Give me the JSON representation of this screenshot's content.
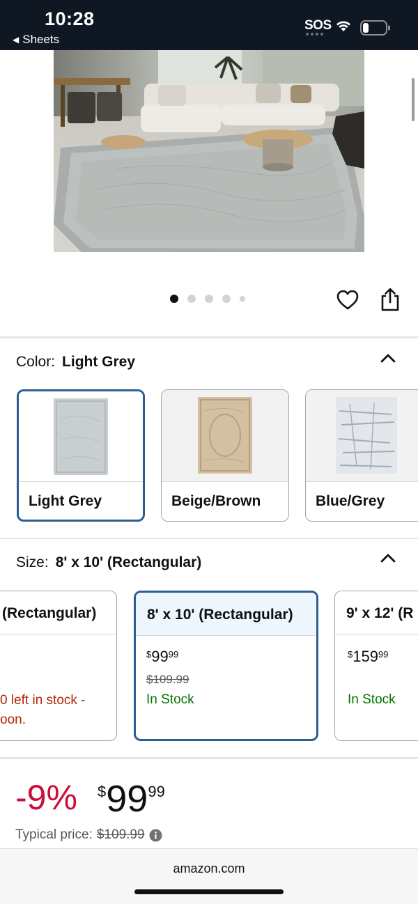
{
  "status_bar": {
    "time": "10:28",
    "back_label": "Sheets",
    "sos": "SOS"
  },
  "product_image": {
    "description_icon": "living-room-rug-photo"
  },
  "carousel": {
    "count": 5,
    "active_index": 0
  },
  "color_section": {
    "label": "Color:",
    "selected": "Light Grey",
    "options": [
      {
        "name": "Light Grey",
        "swatch": "#c9ced0"
      },
      {
        "name": "Beige/Brown",
        "swatch": "#cdb79a"
      },
      {
        "name": "Blue/Grey",
        "swatch": "#aeb7c2"
      }
    ]
  },
  "size_section": {
    "label": "Size:",
    "selected": "8' x 10' (Rectangular)",
    "options": [
      {
        "name": "(Rectangular)",
        "stock_line1": "0 left in stock -",
        "stock_line2": "oon."
      },
      {
        "name": "8' x 10' (Rectangular)",
        "price_dollars": "99",
        "price_cents": "99",
        "list_price": "$109.99",
        "stock": "In Stock"
      },
      {
        "name": "9' x 12' (R",
        "price_dollars": "159",
        "price_cents": "99",
        "stock": "In Stock"
      }
    ]
  },
  "pricing": {
    "discount": "-9%",
    "currency": "$",
    "dollars": "99",
    "cents": "99",
    "typical_label": "Typical price:",
    "typical_price": "$109.99"
  },
  "browser": {
    "url": "amazon.com"
  },
  "colors": {
    "selected_border": "#2b5e93",
    "discount": "#cc0c39",
    "in_stock": "#007600",
    "low_stock": "#b12704"
  }
}
